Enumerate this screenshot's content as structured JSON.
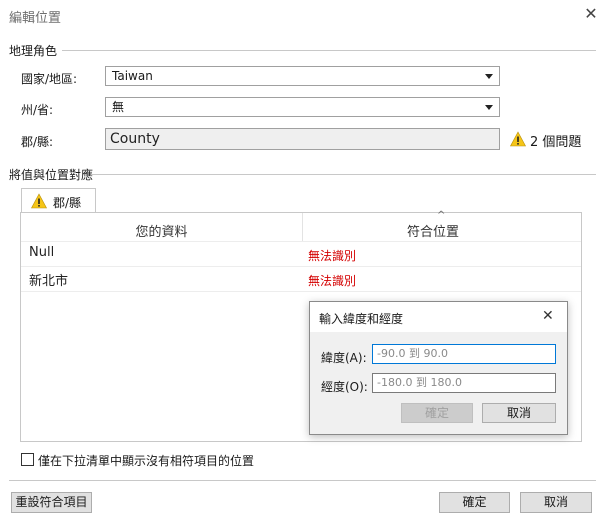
{
  "window": {
    "title": "編輯位置",
    "close_glyph": "✕"
  },
  "geo_section": {
    "title": "地理角色",
    "country": {
      "label": "國家/地區:",
      "value": "Taiwan"
    },
    "state": {
      "label": "州/省:",
      "value": "無"
    },
    "county": {
      "label": "郡/縣:",
      "value": "County",
      "issues": "2 個問題"
    }
  },
  "match_section": {
    "title": "將值與位置對應",
    "tab_label": "郡/縣",
    "columns": {
      "your_data": "您的資料",
      "matching_location": "符合位置"
    },
    "rows": [
      {
        "data": "Null",
        "match": "無法識別"
      },
      {
        "data": "新北市",
        "match": "無法識別"
      }
    ]
  },
  "popup": {
    "title": "輸入緯度和經度",
    "close_glyph": "✕",
    "latitude": {
      "label": "緯度(A):",
      "placeholder": "-90.0 到 90.0"
    },
    "longitude": {
      "label": "經度(O):",
      "placeholder": "-180.0 到 180.0"
    },
    "ok_label": "確定",
    "cancel_label": "取消"
  },
  "footer": {
    "checkbox_label": "僅在下拉清單中顯示沒有相符項目的位置",
    "reset_label": "重設符合項目",
    "ok_label": "確定",
    "cancel_label": "取消"
  },
  "colors": {
    "warning": "#f5c518",
    "error_text": "#d40000",
    "focus_border": "#0078d7"
  }
}
